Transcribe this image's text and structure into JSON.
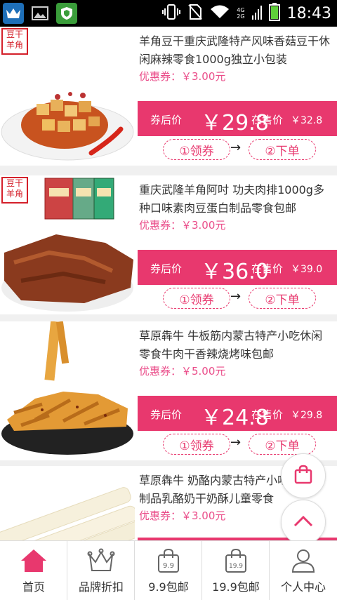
{
  "status_bar": {
    "time": "18:43",
    "network": [
      "4G",
      "2G"
    ],
    "icons": [
      "crown-app-icon",
      "image-icon",
      "shield-app-icon",
      "vibrate-icon",
      "no-sim-icon",
      "wifi-icon",
      "signal-icon",
      "battery-icon"
    ]
  },
  "products": [
    {
      "title": "羊角豆干重庆武隆特产风味香菇豆干休闲麻辣零食1000g独立小包装",
      "coupon": "优惠券：￥3.00元",
      "after_label": "券后价",
      "after_price": "￥29.8",
      "sale_label": "在售价",
      "sale_price": "￥32.8",
      "step1": "①领券",
      "step2": "②下单",
      "badge": "豆干羊角"
    },
    {
      "title": "重庆武隆羊角阿吋 功夫肉排1000g多种口味素肉豆蛋白制品零食包邮",
      "coupon": "优惠券：￥3.00元",
      "after_label": "券后价",
      "after_price": "￥36.0",
      "sale_label": "在售价",
      "sale_price": "￥39.0",
      "step1": "①领券",
      "step2": "②下单",
      "badge": "豆干羊角"
    },
    {
      "title": "草原犇牛 牛板筋内蒙古特产小吃休闲零食牛肉干香辣烧烤味包邮",
      "coupon": "优惠券：￥5.00元",
      "after_label": "券后价",
      "after_price": "￥24.8",
      "sale_label": "在售价",
      "sale_price": "￥29.8",
      "step1": "①领券",
      "step2": "②下单"
    },
    {
      "title": "草原犇牛 奶酪内蒙古特产小吃奶条奶制品乳酪奶干奶酥儿童零食",
      "coupon": "优惠券：￥3.00元"
    }
  ],
  "fab": {
    "cart_icon": "shopping-bag-icon",
    "top_icon": "chevron-up-icon"
  },
  "tabs": [
    {
      "label": "首页",
      "icon": "home-icon"
    },
    {
      "label": "品牌折扣",
      "icon": "crown-icon"
    },
    {
      "label": "9.9包邮",
      "icon": "bag-9.9-icon"
    },
    {
      "label": "19.9包邮",
      "icon": "bag-19.9-icon"
    },
    {
      "label": "个人中心",
      "icon": "user-icon"
    }
  ],
  "colors": {
    "accent": "#e8386e",
    "coupon_text": "#ea4c89",
    "home_active": "#e8386e"
  }
}
